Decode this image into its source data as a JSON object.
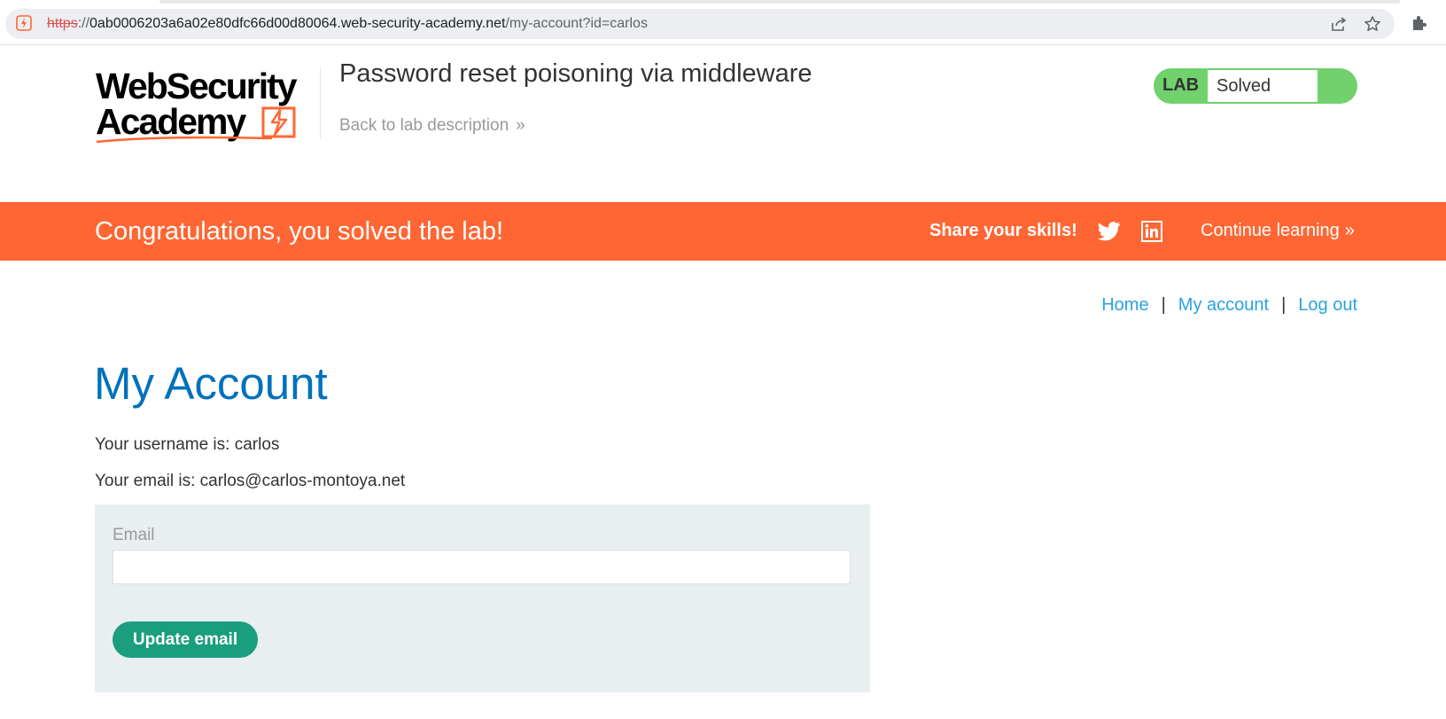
{
  "browser": {
    "url_scheme": "https",
    "url_separator": "://",
    "url_host": "0ab0006203a6a02e80dfc66d00d80064.web-security-academy.net",
    "url_path": "/my-account?id=carlos",
    "icons": [
      "site-info-icon",
      "share-icon",
      "star-icon",
      "extensions-icon"
    ]
  },
  "header": {
    "logo_line1": "WebSecurity",
    "logo_line2": "Academy",
    "lab_title": "Password reset poisoning via middleware",
    "back_link": "Back to lab description",
    "back_chevron": "»",
    "lab_badge": "LAB",
    "lab_status": "Solved",
    "status_color": "#70d16d"
  },
  "banner": {
    "message": "Congratulations, you solved the lab!",
    "share_label": "Share your skills!",
    "continue_label": "Continue learning",
    "continue_chevron": "»",
    "background": "#ff6633"
  },
  "nav": {
    "home": "Home",
    "separator": "|",
    "my_account": "My account",
    "log_out": "Log out"
  },
  "account": {
    "title": "My Account",
    "username_line": "Your username is: carlos",
    "email_line": "Your email is: carlos@carlos-montoya.net",
    "email_label": "Email",
    "email_value": "",
    "update_button": "Update email"
  }
}
